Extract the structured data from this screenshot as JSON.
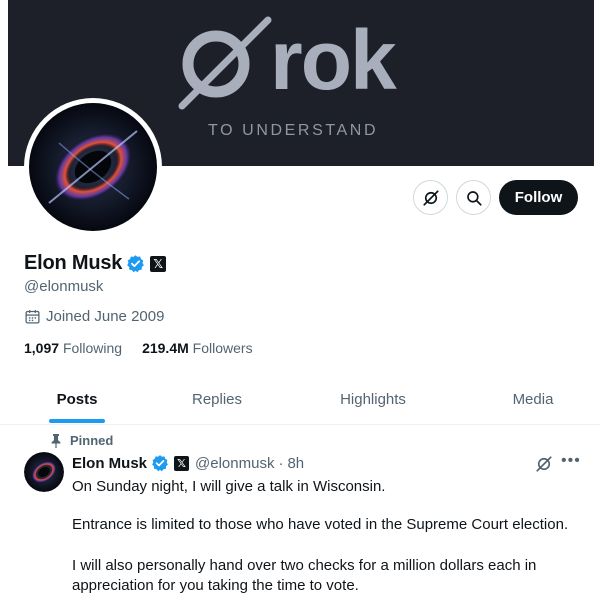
{
  "banner": {
    "logo_text": "rok",
    "tagline": "TO UNDERSTAND"
  },
  "profile": {
    "name": "Elon Musk",
    "x_badge": "𝕏",
    "handle": "@elonmusk",
    "joined": "Joined June 2009",
    "following_count": "1,097",
    "following_label": "Following",
    "followers_count": "219.4M",
    "followers_label": "Followers"
  },
  "actions": {
    "follow_label": "Follow"
  },
  "tabs": [
    {
      "label": "Posts",
      "active": true
    },
    {
      "label": "Replies",
      "active": false
    },
    {
      "label": "Highlights",
      "active": false
    },
    {
      "label": "Media",
      "active": false
    }
  ],
  "post": {
    "pinned_label": "Pinned",
    "author": "Elon Musk",
    "x_badge": "𝕏",
    "handle": "@elonmusk",
    "separator": "·",
    "time": "8h",
    "more": "•••",
    "paragraphs": [
      "On Sunday night, I will give a talk in Wisconsin.",
      "Entrance is limited to those who have voted in the Supreme Court election.",
      "I will also personally hand over two checks for a million dollars each in appreciation for you taking the time to vote."
    ]
  },
  "icons": {
    "grok": "grok-icon",
    "search": "search-icon",
    "calendar": "calendar-icon",
    "pin": "pin-icon",
    "verified": "verified-badge-icon"
  },
  "colors": {
    "accent": "#1d9bf0",
    "text": "#0f1419",
    "muted": "#536471",
    "banner_bg": "#1d2029"
  }
}
